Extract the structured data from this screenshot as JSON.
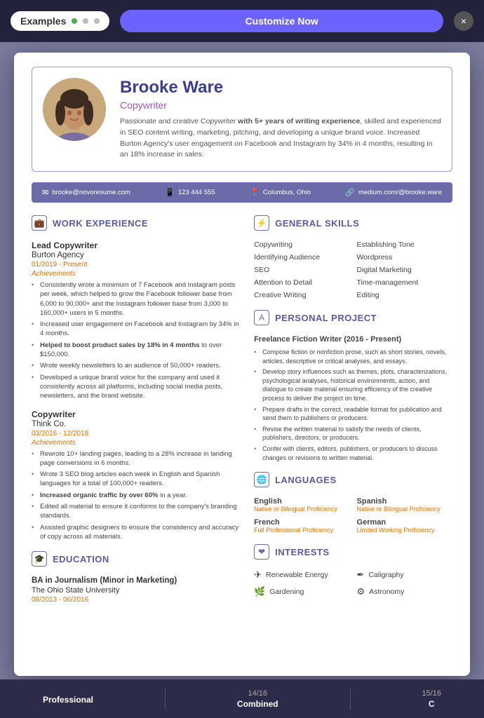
{
  "topbar": {
    "examples_label": "Examples",
    "customize_label": "Customize Now",
    "close_icon": "×",
    "dot1": "green",
    "dot2": "gray",
    "dot3": "gray"
  },
  "resume": {
    "name": "Brooke Ware",
    "title": "Copywriter",
    "description_p1": "Passionate and creative Copywriter ",
    "description_bold1": "with 5+ years of writing experience",
    "description_p2": ", skilled and experienced in SEO content writing, marketing, pitching, and developing a unique brand voice. Increased Burton Agency's user engagement on Facebook and Instagram by 34% in 4 months, resulting in an 18% increase in sales.",
    "contact": {
      "email": "brooke@novoresume.com",
      "phone": "123 444 555",
      "location": "Columbus, Ohio",
      "website": "medium.com/@brooke.ware"
    },
    "work_experience": {
      "section_title": "WORK EXPERIENCE",
      "jobs": [
        {
          "title": "Lead Copywriter",
          "company": "Burton Agency",
          "dates": "01/2019 - Present",
          "achievements_label": "Achievements",
          "bullets": [
            "Consistently wrote a minimum of 7 Facebook and Instagram posts per week, which helped to grow the Facebook follower base from 6,000 to 90,000+ and the Instagram follower base from 3,000 to 160,000+ users in 5 months.",
            "Increased user engagement on Facebook and Instagram by 34% in 4 months.",
            "Helped to boost product sales by 18% in 4 months to over $150,000.",
            "Wrote weekly newsletters to an audience of 50,000+ readers.",
            "Developed a unique brand voice for the company and used it consistently across all platforms, including social media posts, newsletters, and the brand website."
          ]
        },
        {
          "title": "Copywriter",
          "company": "Think Co.",
          "dates": "03/2016 - 12/2018",
          "achievements_label": "Achievements",
          "bullets": [
            "Rewrote 10+ landing pages, leading to a 28% increase in landing page conversions in 6 months.",
            "Wrote 3 SEO blog articles each week in English and Spanish languages for a total of 100,000+ readers.",
            "Increased organic traffic by over 60% in a year.",
            "Edited all material to ensure it conforms to the company's branding standards.",
            "Assisted graphic designers to ensure the consistency and accuracy of copy across all materials."
          ]
        }
      ]
    },
    "education": {
      "section_title": "EDUCATION",
      "degree": "BA in Journalism (Minor in Marketing)",
      "school": "The Ohio State University",
      "dates": "08/2013 - 06/2016"
    },
    "general_skills": {
      "section_title": "GENERAL SKILLS",
      "skills": [
        {
          "name": "Copywriting",
          "col": 1
        },
        {
          "name": "Establishing Tone",
          "col": 2
        },
        {
          "name": "Identifying Audience",
          "col": 1
        },
        {
          "name": "Wordpress",
          "col": 2
        },
        {
          "name": "SEO",
          "col": 1
        },
        {
          "name": "Digital Marketing",
          "col": 2
        },
        {
          "name": "Attention to Detail",
          "col": 1
        },
        {
          "name": "Time-management",
          "col": 2
        },
        {
          "name": "Creative Writing",
          "col": 1
        },
        {
          "name": "Editing",
          "col": 2
        }
      ]
    },
    "personal_project": {
      "section_title": "PERSONAL PROJECT",
      "project_title": "Freelance Fiction Writer (2016 - Present)",
      "bullets": [
        "Compose fiction or nonfiction prose, such as short stories, novels, articles, descriptive or critical analyses, and essays.",
        "Develop story influences such as themes, plots, characterizations, psychological analyses, historical environments, action, and dialogue to create material ensuring efficiency of the creative process to deliver the project on time.",
        "Prepare drafts in the correct, readable format for publication and send them to publishers or producers.",
        "Revise the written material to satisfy the needs of clients, publishers, directors, or producers.",
        "Confer with clients, editors, publishers, or producers to discuss changes or revisions to written material."
      ]
    },
    "languages": {
      "section_title": "LANGUAGES",
      "langs": [
        {
          "name": "English",
          "level": "Native or Bilingual Proficiency"
        },
        {
          "name": "Spanish",
          "level": "Native or Bilingual Proficiency"
        },
        {
          "name": "French",
          "level": "Full Professional Proficiency"
        },
        {
          "name": "German",
          "level": "Limited Working Proficiency"
        }
      ]
    },
    "interests": {
      "section_title": "INTERESTS",
      "items": [
        {
          "name": "Renewable Energy",
          "icon": "✈"
        },
        {
          "name": "Caligraphy",
          "icon": "✒"
        },
        {
          "name": "Gardening",
          "icon": "🌿"
        },
        {
          "name": "Astronomy",
          "icon": "⚙"
        }
      ]
    }
  },
  "bottom": {
    "items": [
      {
        "num": "",
        "label": "Professional"
      },
      {
        "num": "14/16",
        "label": "Combined"
      },
      {
        "num": "15/16",
        "label": "C"
      }
    ]
  }
}
